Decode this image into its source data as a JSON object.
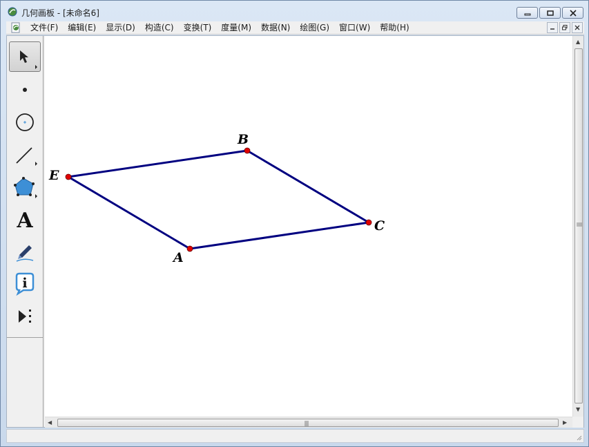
{
  "window": {
    "title": "几何画板 - [未命名6]",
    "minimize_icon": "minimize-icon",
    "maximize_icon": "restore-icon",
    "close_icon": "close-icon"
  },
  "menubar": {
    "items": [
      {
        "label": "文件(F)"
      },
      {
        "label": "编辑(E)"
      },
      {
        "label": "显示(D)"
      },
      {
        "label": "构造(C)"
      },
      {
        "label": "变换(T)"
      },
      {
        "label": "度量(M)"
      },
      {
        "label": "数据(N)"
      },
      {
        "label": "绘图(G)"
      },
      {
        "label": "窗口(W)"
      },
      {
        "label": "帮助(H)"
      }
    ]
  },
  "toolbox": {
    "tools": [
      {
        "name": "arrow-select-tool",
        "icon": "arrow-icon",
        "active": true
      },
      {
        "name": "point-tool",
        "icon": "point-icon"
      },
      {
        "name": "compass-tool",
        "icon": "circle-icon"
      },
      {
        "name": "straightedge-tool",
        "icon": "segment-icon"
      },
      {
        "name": "polygon-tool",
        "icon": "pentagon-icon"
      },
      {
        "name": "text-tool",
        "icon": "text-a-icon",
        "glyph": "A"
      },
      {
        "name": "marker-tool",
        "icon": "marker-pen-icon"
      },
      {
        "name": "information-tool",
        "icon": "info-icon",
        "glyph": "i"
      },
      {
        "name": "custom-tool",
        "icon": "custom-tool-icon"
      }
    ]
  },
  "sketch": {
    "segment_color": "#000080",
    "point_color": "#e00000",
    "points": [
      {
        "label": "A"
      },
      {
        "label": "B"
      },
      {
        "label": "C"
      },
      {
        "label": "E"
      }
    ],
    "segments": [
      [
        "E",
        "B"
      ],
      [
        "B",
        "C"
      ],
      [
        "C",
        "A"
      ],
      [
        "A",
        "E"
      ]
    ]
  },
  "colors": {
    "canvas_background": "#ffffff",
    "chrome_background": "#f0f0f0",
    "pentagon_fill": "#3d8fd6"
  }
}
